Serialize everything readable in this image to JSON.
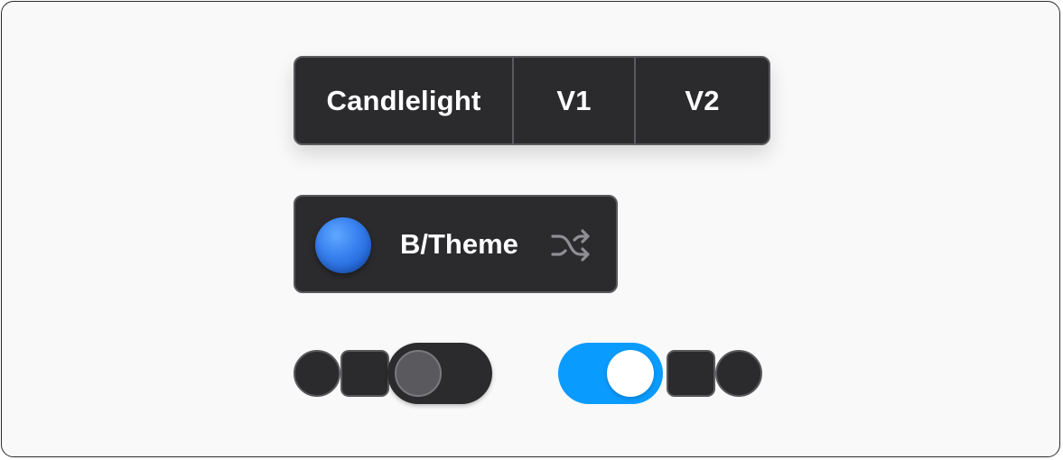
{
  "segmented_control": {
    "options": [
      {
        "label": "Candlelight"
      },
      {
        "label": "V1"
      },
      {
        "label": "V2"
      }
    ]
  },
  "theme_picker": {
    "label": "B/Theme",
    "swatch_color": "#3a82f0",
    "shuffle_icon": "shuffle-icon"
  },
  "toggles": {
    "left": {
      "state": "off",
      "track_color": "#2b2b2e",
      "knob_color": "#5a5a5e"
    },
    "right": {
      "state": "on",
      "track_color": "#0a9bff",
      "knob_color": "#ffffff"
    }
  },
  "colors": {
    "surface": "#2b2b2e",
    "border": "#5a5a5e",
    "accent": "#0a9bff",
    "background": "#f9f9f9"
  }
}
